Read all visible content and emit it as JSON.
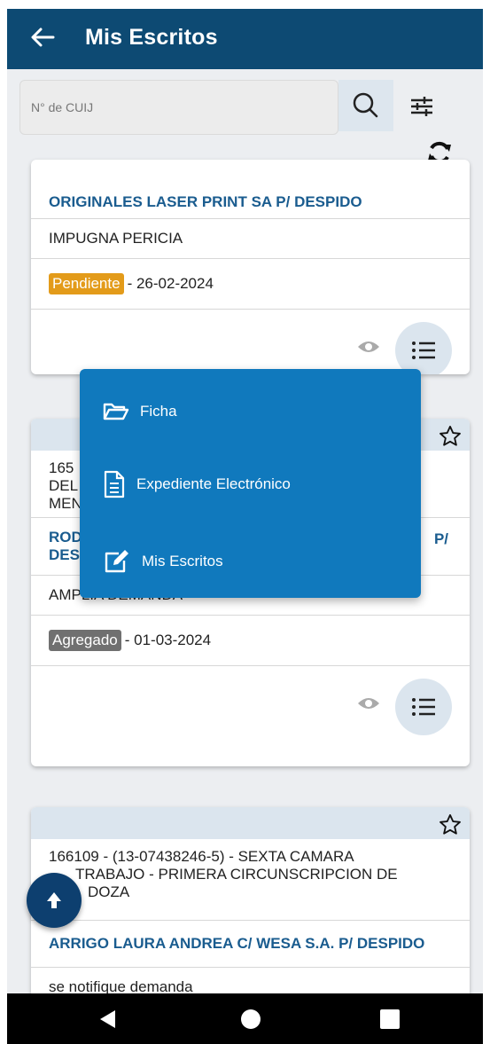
{
  "appbar": {
    "title": "Mis Escritos"
  },
  "search": {
    "placeholder": "N° de CUIJ",
    "value": ""
  },
  "cards": [
    {
      "court_partial": "",
      "party": "ORIGINALES LASER PRINT SA P/ DESPIDO",
      "description": "IMPUGNA PERICIA",
      "status": "Pendiente",
      "date": "- 26-02-2024"
    },
    {
      "court_line1": "165",
      "court_line2": "DEL",
      "court_line3": "MEN",
      "party_line1": "ROD",
      "party_line1_end": "P/",
      "party_line2": "DES",
      "description": "AMPLIA DEMANDA",
      "status": "Agregado",
      "date": "- 01-03-2024"
    },
    {
      "court_line1": "166109 - (13-07438246-5)  - SEXTA CAMARA",
      "court_line2": "TRABAJO - PRIMERA CIRCUNSCRIPCION DE",
      "court_line3": "DOZA",
      "party": "ARRIGO LAURA ANDREA C/ WESA S.A. P/ DESPIDO",
      "description": "se notifique demanda"
    }
  ],
  "menu": {
    "items": [
      {
        "label": "Ficha",
        "icon": "folder-open-icon"
      },
      {
        "label": "Expediente Electrónico",
        "icon": "document-icon"
      },
      {
        "label": "Mis Escritos",
        "icon": "edit-icon"
      }
    ]
  },
  "colors": {
    "appbar": "#0d4a73",
    "menu": "#1079bd",
    "party_text": "#1a5c8f",
    "badge_pendiente": "#e39b1a",
    "badge_agregado": "#707070",
    "fab": "#0d3f6f"
  }
}
